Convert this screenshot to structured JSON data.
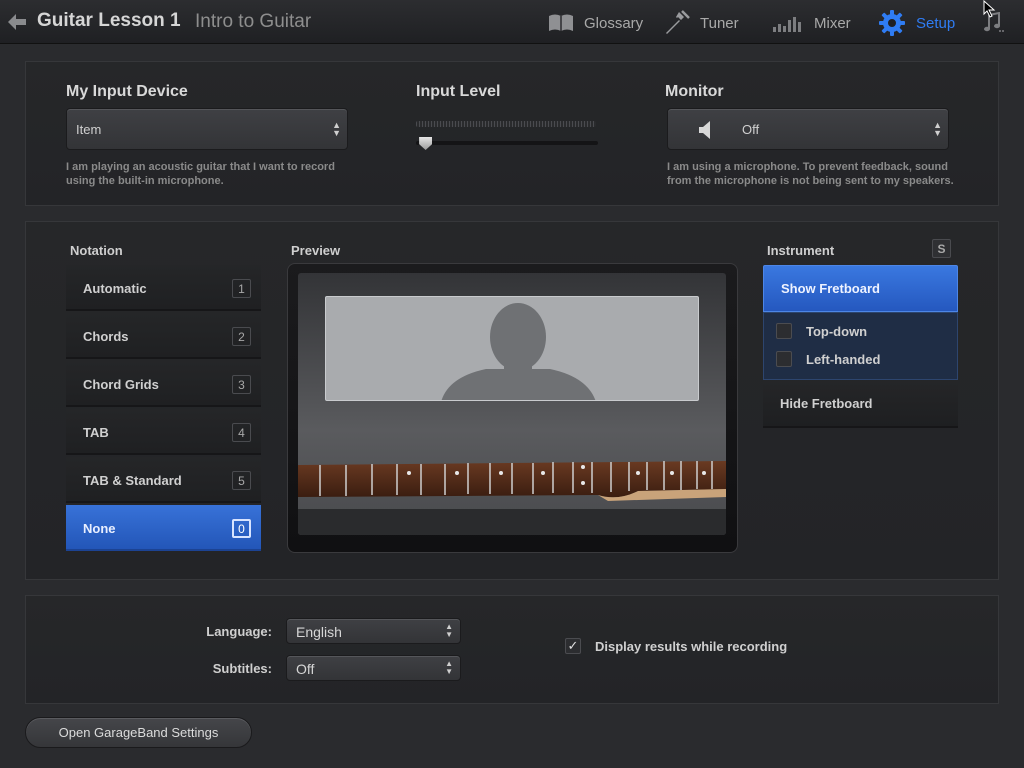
{
  "header": {
    "title": "Guitar Lesson 1",
    "subtitle": "Intro to Guitar",
    "nav": [
      {
        "label": "Glossary",
        "icon": "book-icon"
      },
      {
        "label": "Tuner",
        "icon": "tuning-fork-icon"
      },
      {
        "label": "Mixer",
        "icon": "mixer-bars-icon"
      },
      {
        "label": "Setup",
        "icon": "gear-icon",
        "active": true
      }
    ]
  },
  "input": {
    "device_label": "My Input Device",
    "device_value": "Item",
    "device_help": "I am playing an acoustic guitar that I want to record using the built-in microphone.",
    "level_label": "Input Level",
    "level_value": 0.03,
    "monitor_label": "Monitor",
    "monitor_value": "Off",
    "monitor_help": "I am using a microphone. To prevent feedback, sound from the microphone is not being sent to my speakers."
  },
  "notation": {
    "label": "Notation",
    "items": [
      {
        "label": "Automatic",
        "key": "1"
      },
      {
        "label": "Chords",
        "key": "2"
      },
      {
        "label": "Chord Grids",
        "key": "3"
      },
      {
        "label": "TAB",
        "key": "4"
      },
      {
        "label": "TAB & Standard",
        "key": "5"
      },
      {
        "label": "None",
        "key": "0",
        "active": true
      }
    ]
  },
  "preview": {
    "label": "Preview"
  },
  "instrument": {
    "label": "Instrument",
    "key": "S",
    "show_label": "Show Fretboard",
    "options": [
      {
        "label": "Top-down",
        "checked": false
      },
      {
        "label": "Left-handed",
        "checked": false
      }
    ],
    "hide_label": "Hide Fretboard"
  },
  "settings": {
    "language_label": "Language:",
    "language_value": "English",
    "subtitles_label": "Subtitles:",
    "subtitles_value": "Off",
    "display_results_label": "Display results while recording",
    "display_results_checked": true,
    "open_button": "Open GarageBand Settings"
  },
  "colors": {
    "accent": "#2f7cf3",
    "selected_fill": "#2a62c9"
  }
}
